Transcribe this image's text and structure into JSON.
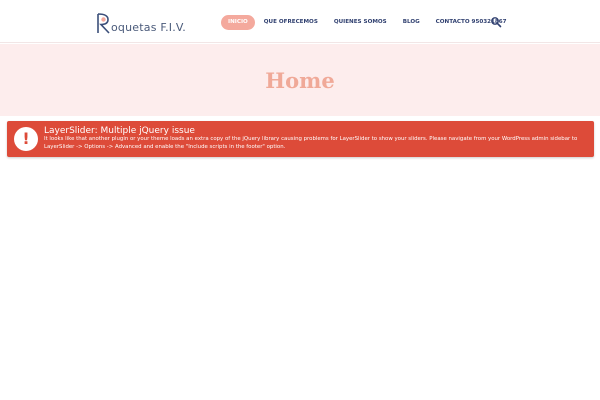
{
  "header": {
    "logo_text": "oquetas F.I.V.",
    "nav": [
      {
        "label": "INICIO",
        "active": true
      },
      {
        "label": "QUE OFRECEMOS",
        "active": false
      },
      {
        "label": "QUIENES SOMOS",
        "active": false
      },
      {
        "label": "BLOG",
        "active": false
      },
      {
        "label": "CONTACTO 950321867",
        "active": false
      }
    ],
    "search_icon": "search-icon"
  },
  "hero": {
    "title": "Home"
  },
  "alert": {
    "icon": "exclamation-icon",
    "icon_glyph": "!",
    "title": "LayerSlider: Multiple jQuery issue",
    "message": "It looks like that another plugin or your theme loads an extra copy of the jQuery library causing problems for LayerSlider to show your sliders. Please navigate from your WordPress admin sidebar to LayerSlider -> Options -> Advanced and enable the \"Include scripts in the footer\" option."
  },
  "colors": {
    "nav_active": "#f4a99d",
    "nav_text": "#2f3f6f",
    "hero_bg": "#fdeded",
    "hero_title": "#f0a998",
    "alert_bg": "#dd4b39"
  }
}
